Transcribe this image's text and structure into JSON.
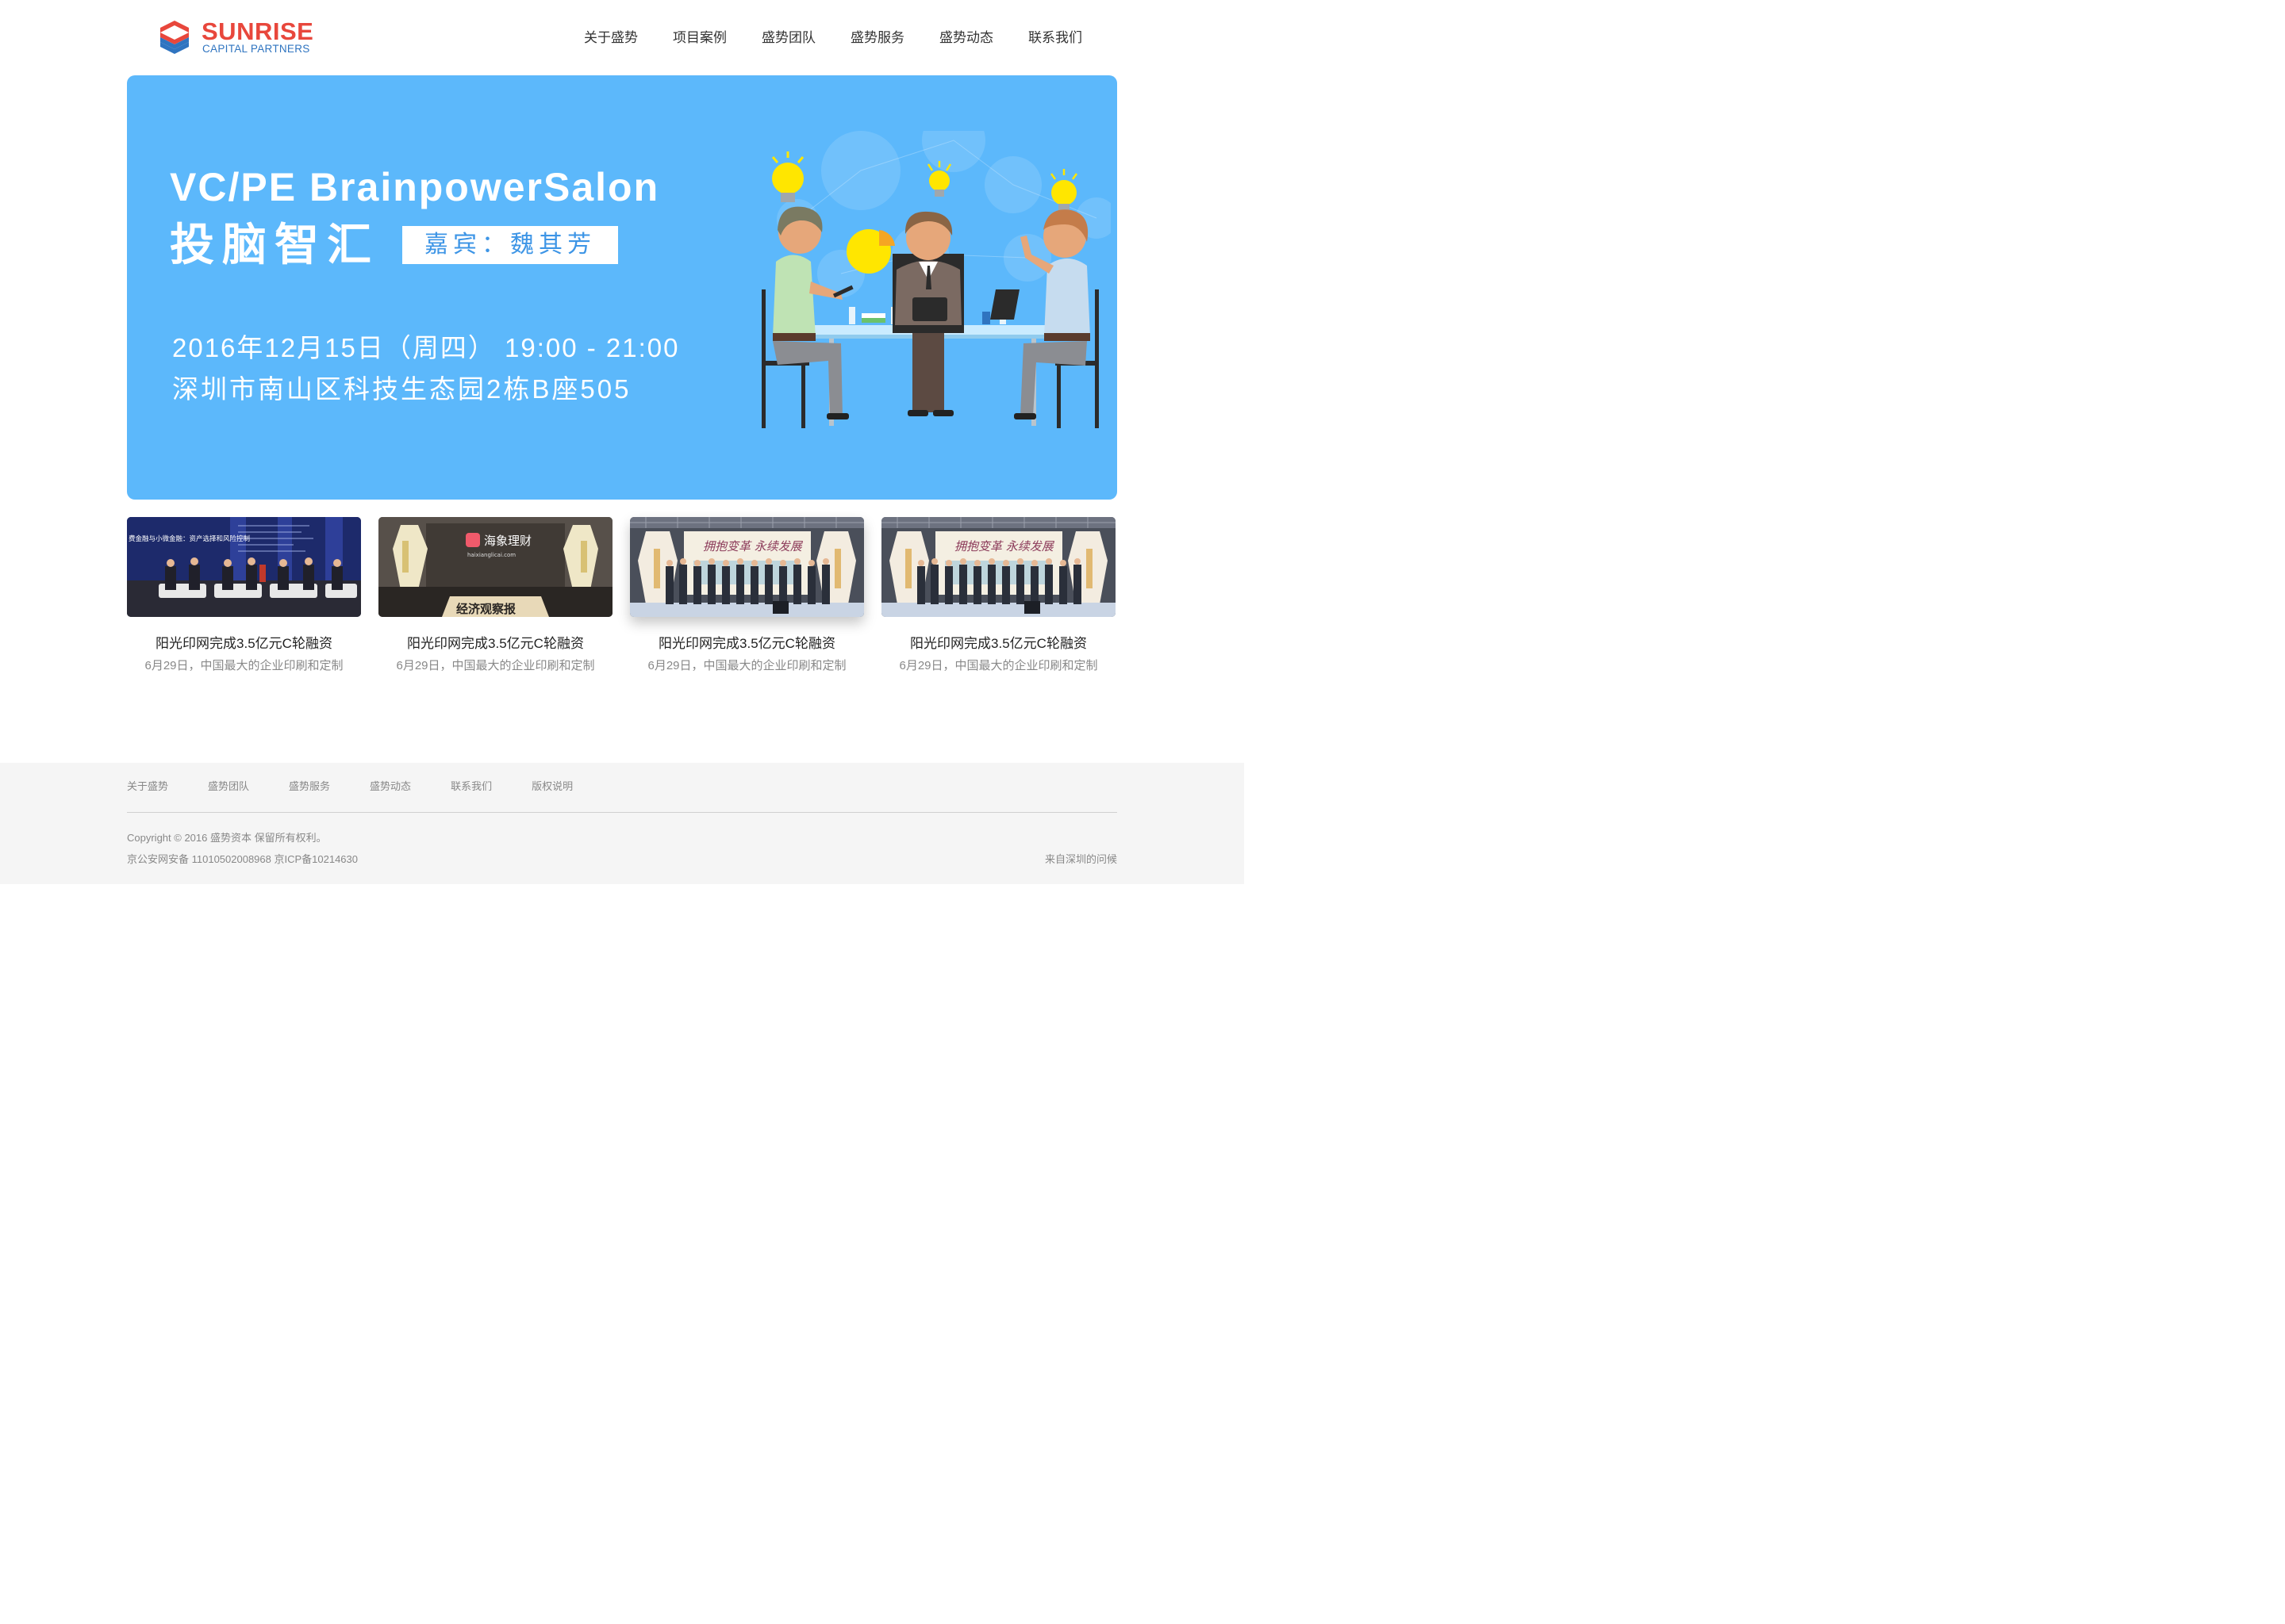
{
  "brand": {
    "name": "SUNRISE",
    "sub": "CAPITAL PARTNERS",
    "primary_color": "#e8473c",
    "secondary_color": "#2f74c0"
  },
  "nav": {
    "items": [
      {
        "label": "关于盛势"
      },
      {
        "label": "项目案例"
      },
      {
        "label": "盛势团队"
      },
      {
        "label": "盛势服务"
      },
      {
        "label": "盛势动态"
      },
      {
        "label": "联系我们"
      }
    ]
  },
  "banner": {
    "title_en": "VC/PE BrainpowerSalon",
    "title_cn": "投脑智汇",
    "guest": "嘉宾：魏其芳",
    "datetime": "2016年12月15日（周四） 19:00 - 21:00",
    "address": "深圳市南山区科技生态园2栋B座505",
    "background_color": "#5cb8fb"
  },
  "news": {
    "items": [
      {
        "title": "阳光印网完成3.5亿元C轮融资",
        "desc": "6月29日，中国最大的企业印刷和定制"
      },
      {
        "title": "阳光印网完成3.5亿元C轮融资",
        "desc": "6月29日，中国最大的企业印刷和定制"
      },
      {
        "title": "阳光印网完成3.5亿元C轮融资",
        "desc": "6月29日，中国最大的企业印刷和定制"
      },
      {
        "title": "阳光印网完成3.5亿元C轮融资",
        "desc": "6月29日，中国最大的企业印刷和定制"
      }
    ],
    "photo_texts": {
      "forum_banner": "费金融与小微金融：资产选择和风险控制",
      "sponsor_cn": "海象理财",
      "sponsor_url": "haixianglicai.com",
      "newspaper": "经济观察报",
      "stage_banner": "拥抱变革 永续发展"
    }
  },
  "footer": {
    "links": [
      {
        "label": "关于盛势"
      },
      {
        "label": "盛势团队"
      },
      {
        "label": "盛势服务"
      },
      {
        "label": "盛势动态"
      },
      {
        "label": "联系我们"
      },
      {
        "label": "版权说明"
      }
    ],
    "copyright": "Copyright © 2016 盛势资本 保留所有权利。",
    "icp": "京公安网安备 11010502008968 京ICP备10214630",
    "greeting": "来自深圳的问候"
  }
}
